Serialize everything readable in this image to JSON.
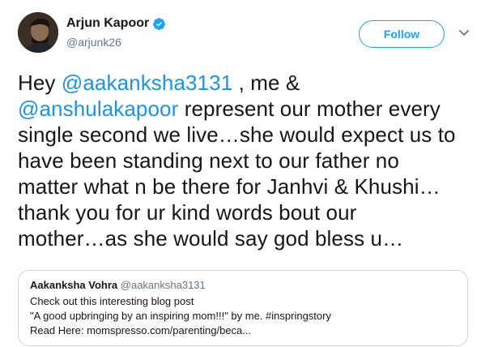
{
  "author": {
    "name": "Arjun Kapoor",
    "handle": "@arjunk26",
    "verified": true
  },
  "follow_label": "Follow",
  "tweet": {
    "lines": [
      {
        "parts": [
          {
            "text": "Hey ",
            "mention": false
          },
          {
            "text": "@aakanksha3131",
            "mention": true
          },
          {
            "text": " , me &",
            "mention": false
          }
        ]
      },
      {
        "parts": [
          {
            "text": "@anshulakapoor",
            "mention": true
          },
          {
            "text": " represent our mother every",
            "mention": false
          }
        ]
      },
      {
        "parts": [
          {
            "text": "single second we live…she would expect us to",
            "mention": false
          }
        ]
      },
      {
        "parts": [
          {
            "text": "have been standing next to our father no",
            "mention": false
          }
        ]
      },
      {
        "parts": [
          {
            "text": "matter what n be there for Janhvi & Khushi…",
            "mention": false
          }
        ]
      },
      {
        "parts": [
          {
            "text": "thank you for ur kind words bout our",
            "mention": false
          }
        ]
      },
      {
        "parts": [
          {
            "text": "mother…as she would say god bless u…",
            "mention": false
          }
        ]
      }
    ]
  },
  "quoted": {
    "name": "Aakanksha Vohra",
    "handle": "@aakanksha3131",
    "lines": [
      "Check out this interesting blog post",
      "\"A good upbringing by an inspiring mom!!!\" by me. #inspringstory",
      "Read Here: momspresso.com/parenting/beca..."
    ]
  },
  "colors": {
    "accent": "#1da1f2",
    "mention": "#1b95e0",
    "text": "#14171a",
    "muted": "#657786"
  },
  "icons": [
    "verified-badge-icon",
    "chevron-down-icon"
  ]
}
